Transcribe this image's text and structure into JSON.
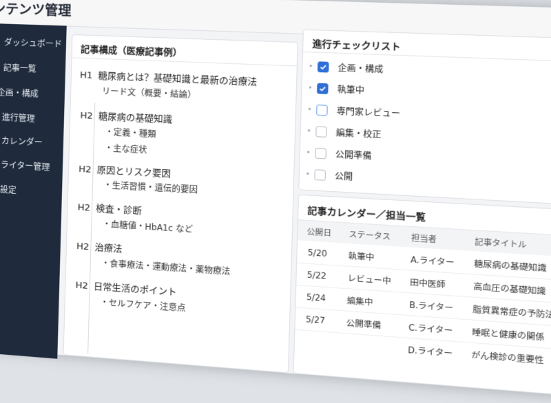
{
  "app": {
    "title": "ンテンツ管理"
  },
  "sidebar": {
    "items": [
      {
        "label": "ダッシュボード",
        "icon": "dashboard-icon"
      },
      {
        "label": "記事一覧",
        "icon": "list-icon"
      },
      {
        "label": "企画・構成",
        "icon": "plan-icon"
      },
      {
        "label": "進行管理",
        "icon": "progress-icon"
      },
      {
        "label": "カレンダー",
        "icon": "calendar-icon"
      },
      {
        "label": "ライター管理",
        "icon": "user-icon"
      },
      {
        "label": "設定",
        "icon": "gear-icon"
      }
    ],
    "bg_color": "#1f2b3d"
  },
  "outline": {
    "title": "記事構成（医療記事例）",
    "h1": {
      "level": "H1",
      "text": "糖尿病とは？基礎知識と最新の治療法",
      "lead": "リード文（概要・結論）"
    },
    "sections": [
      {
        "level": "H2",
        "text": "糖尿病の基礎知識",
        "items": [
          "・定義・種類",
          "・主な症状"
        ]
      },
      {
        "level": "H2",
        "text": "原因とリスク要因",
        "items": [
          "・生活習慣・遺伝的要因"
        ]
      },
      {
        "level": "H2",
        "text": "検査・診断",
        "items": [
          "・血糖値・HbA1c など"
        ]
      },
      {
        "level": "H2",
        "text": "治療法",
        "items": [
          "・食事療法・運動療法・薬物療法"
        ]
      },
      {
        "level": "H2",
        "text": "日常生活のポイント",
        "items": [
          "・セルフケア・注意点"
        ]
      }
    ]
  },
  "checklist": {
    "title": "進行チェックリスト",
    "items": [
      {
        "label": "企画・構成",
        "checked": true
      },
      {
        "label": "執筆中",
        "checked": true
      },
      {
        "label": "専門家レビュー",
        "checked": false,
        "focused": true
      },
      {
        "label": "編集・校正",
        "checked": false
      },
      {
        "label": "公開準備",
        "checked": false
      },
      {
        "label": "公開",
        "checked": false
      }
    ],
    "accent": "#2f6fd6"
  },
  "calendar": {
    "title": "記事カレンダー／担当一覧",
    "headers": [
      "公開日",
      "ステータス",
      "担当者",
      "記事タイトル"
    ],
    "rows": [
      [
        "5/20",
        "執筆中",
        "A.ライター",
        "糖尿病の基礎知識"
      ],
      [
        "5/22",
        "レビュー中",
        "田中医師",
        "高血圧の基礎知識"
      ],
      [
        "5/24",
        "編集中",
        "B.ライター",
        "脂質異常症の予防法"
      ],
      [
        "5/27",
        "公開準備",
        "C.ライター",
        "睡眠と健康の関係"
      ],
      [
        "",
        "",
        "D.ライター",
        "がん検診の重要性"
      ]
    ]
  }
}
